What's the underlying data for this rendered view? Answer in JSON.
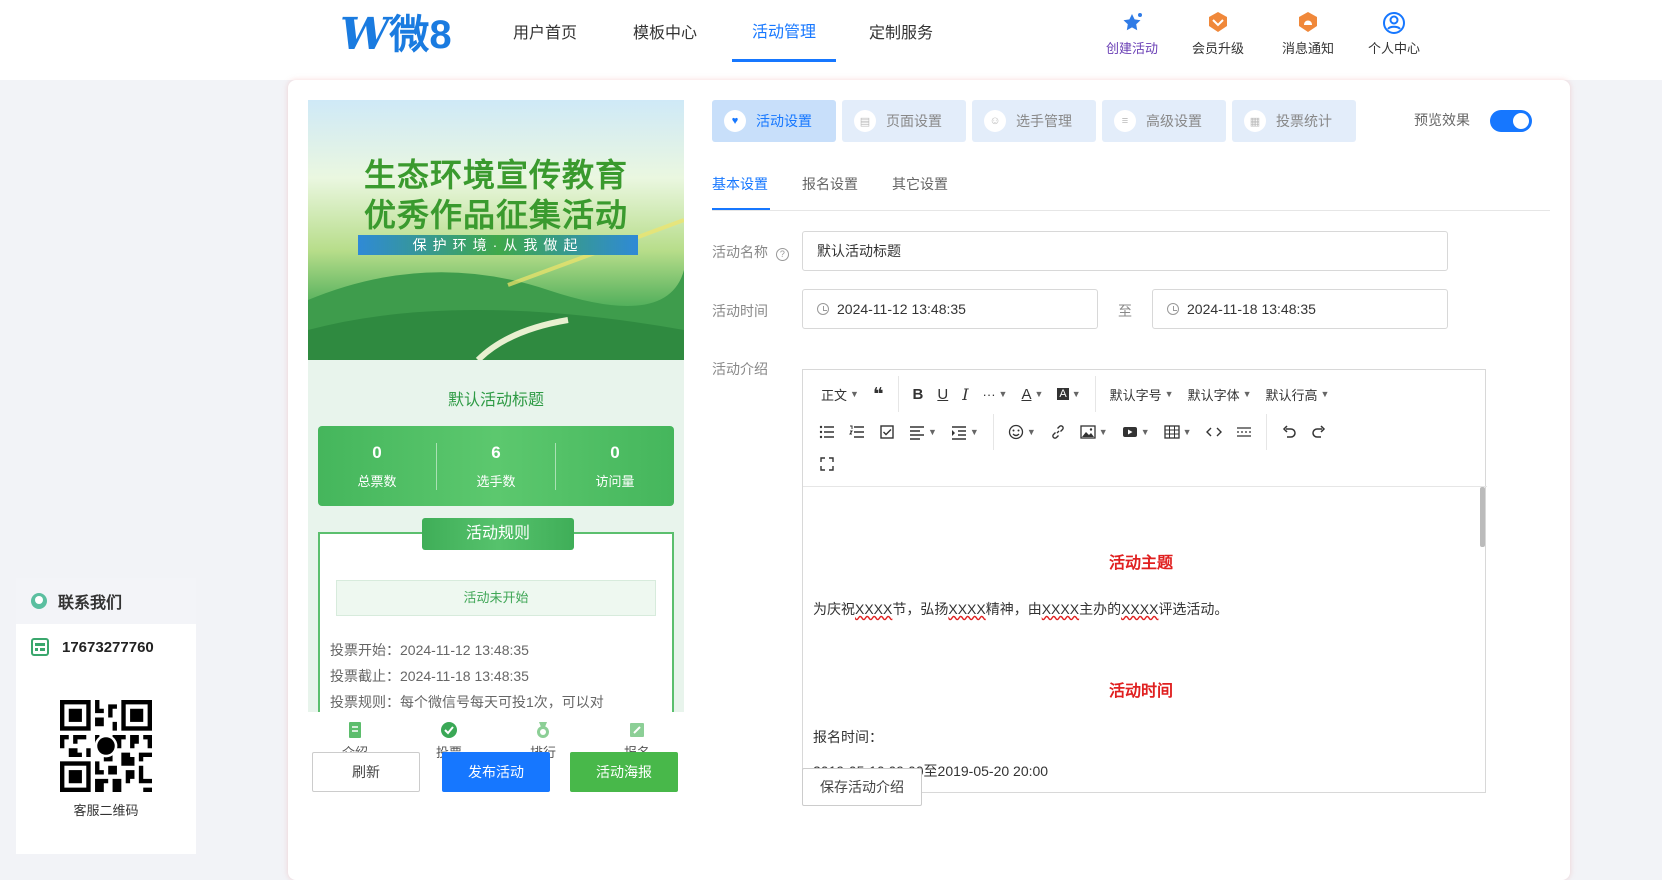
{
  "header": {
    "logo_w": "W",
    "logo_text": "微8",
    "nav": [
      "用户首页",
      "模板中心",
      "活动管理",
      "定制服务"
    ],
    "active_nav": "活动管理",
    "icons": [
      {
        "label": "创建活动",
        "icon": "star-sparkle-icon"
      },
      {
        "label": "会员升级",
        "icon": "vip-badge-icon"
      },
      {
        "label": "消息通知",
        "icon": "bell-badge-icon"
      },
      {
        "label": "个人中心",
        "icon": "user-circle-icon"
      }
    ]
  },
  "contact": {
    "title": "联系我们",
    "phone": "17673277760",
    "qr_caption": "客服二维码"
  },
  "preview": {
    "banner_line1": "生态环境宣传教育",
    "banner_line2": "优秀作品征集活动",
    "banner_strip": "保护环境·从我做起",
    "title": "默认活动标题",
    "stats": [
      {
        "value": "0",
        "label": "总票数"
      },
      {
        "value": "6",
        "label": "选手数"
      },
      {
        "value": "0",
        "label": "访问量"
      }
    ],
    "rules_title": "活动规则",
    "status": "活动未开始",
    "vote_start": "投票开始：2024-11-12 13:48:35",
    "vote_end": "投票截止：2024-11-18 13:48:35",
    "vote_rule": "投票规则：每个微信号每天可投1次，可以对",
    "tabbar": [
      "介绍",
      "投票",
      "排行",
      "报名"
    ],
    "buttons": {
      "refresh": "刷新",
      "publish": "发布活动",
      "poster": "活动海报"
    }
  },
  "settings": {
    "segments": [
      "活动设置",
      "页面设置",
      "选手管理",
      "高级设置",
      "投票统计"
    ],
    "active_segment": "活动设置",
    "preview_label": "预览效果",
    "preview_on": true,
    "subtabs": [
      "基本设置",
      "报名设置",
      "其它设置"
    ],
    "active_subtab": "基本设置",
    "name_label": "活动名称",
    "name_value": "默认活动标题",
    "time_label": "活动时间",
    "time_start": "2024-11-12 13:48:35",
    "time_sep": "至",
    "time_end": "2024-11-18 13:48:35",
    "intro_label": "活动介绍",
    "toolbar": {
      "paragraph": "正文",
      "font_size": "默认字号",
      "font_family": "默认字体",
      "line_height": "默认行高"
    },
    "content": {
      "heading1": "活动主题",
      "para_pre": "为庆祝",
      "para_x1": "XXXX",
      "para_m1": "节，弘扬",
      "para_x2": "XXXX",
      "para_m2": "精神，由",
      "para_x3": "XXXX",
      "para_m3": "主办的",
      "para_x4": "XXXX",
      "para_post": "评选活动。",
      "heading2": "活动时间",
      "signup_label": "报名时间：",
      "signup_value": "2019-05-10 09:00至2019-05-20 20:00"
    },
    "save_button": "保存活动介绍"
  },
  "colors": {
    "accent": "#1677ff",
    "green": "#48b84a",
    "red": "#e02020"
  }
}
